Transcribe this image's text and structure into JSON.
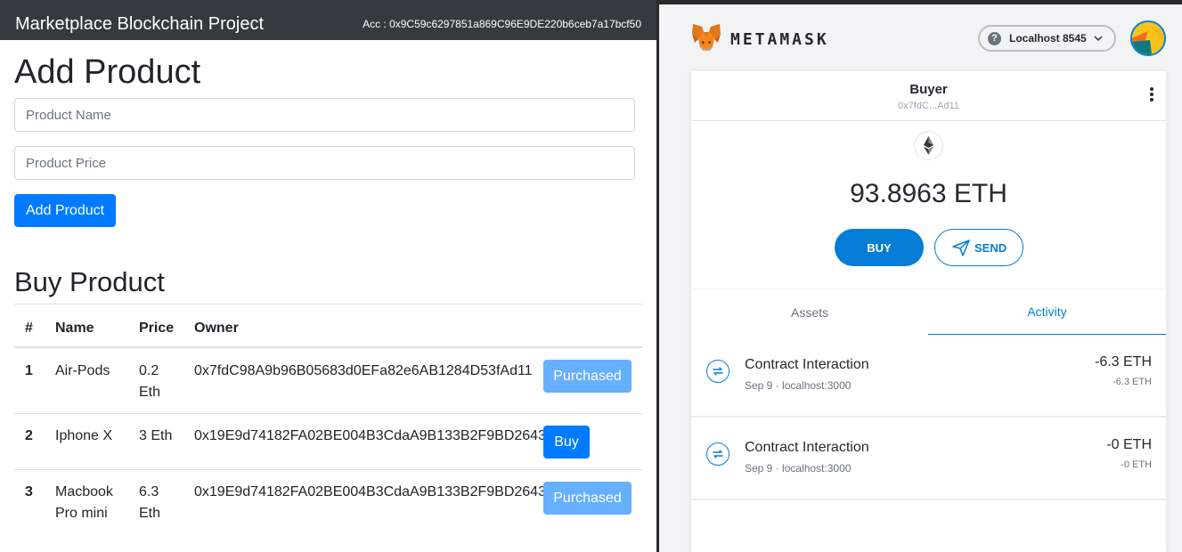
{
  "dapp": {
    "brand": "Marketplace Blockchain Project",
    "account": "Acc : 0x9C59c6297851a869C96E9DE220b6ceb7a17bcf50",
    "add_heading": "Add Product",
    "name_placeholder": "Product Name",
    "price_placeholder": "Product Price",
    "add_button": "Add Product",
    "buy_heading": "Buy Product",
    "table": {
      "headers": [
        "#",
        "Name",
        "Price",
        "Owner"
      ],
      "rows": [
        {
          "id": "1",
          "name_l1": "Air-Pods",
          "name_l2": "",
          "price_l1": "0.2",
          "price_l2": "Eth",
          "owner": "0x7fdC98A9b96B05683d0EFa82e6AB1284D53fAd11",
          "action": "Purchased"
        },
        {
          "id": "2",
          "name_l1": "Iphone X",
          "name_l2": "",
          "price_l1": "3 Eth",
          "price_l2": "",
          "owner": "0x19E9d74182FA02BE004B3CdaA9B133B2F9BD2643",
          "action": "Buy"
        },
        {
          "id": "3",
          "name_l1": "Macbook",
          "name_l2": "Pro mini",
          "price_l1": "6.3",
          "price_l2": "Eth",
          "owner": "0x19E9d74182FA02BE004B3CdaA9B133B2F9BD2643",
          "action": "Purchased"
        }
      ]
    }
  },
  "metamask": {
    "wordmark": "METAMASK",
    "network": "Localhost 8545",
    "account_name": "Buyer",
    "account_address": "0x7fdC...Ad11",
    "balance": "93.8963 ETH",
    "buy_label": "BUY",
    "send_label": "SEND",
    "tabs": [
      "Assets",
      "Activity"
    ],
    "active_tab": "Activity",
    "activity": [
      {
        "title": "Contract Interaction",
        "sub": "Sep 9 · localhost:3000",
        "amount": "-6.3 ETH",
        "amount_sub": "-6.3 ETH"
      },
      {
        "title": "Contract Interaction",
        "sub": "Sep 9 · localhost:3000",
        "amount": "-0 ETH",
        "amount_sub": "-0 ETH"
      }
    ],
    "colors": {
      "accent": "#037dd6",
      "bootstrap_primary": "#007bff",
      "purchased": "#66b0ff"
    }
  }
}
